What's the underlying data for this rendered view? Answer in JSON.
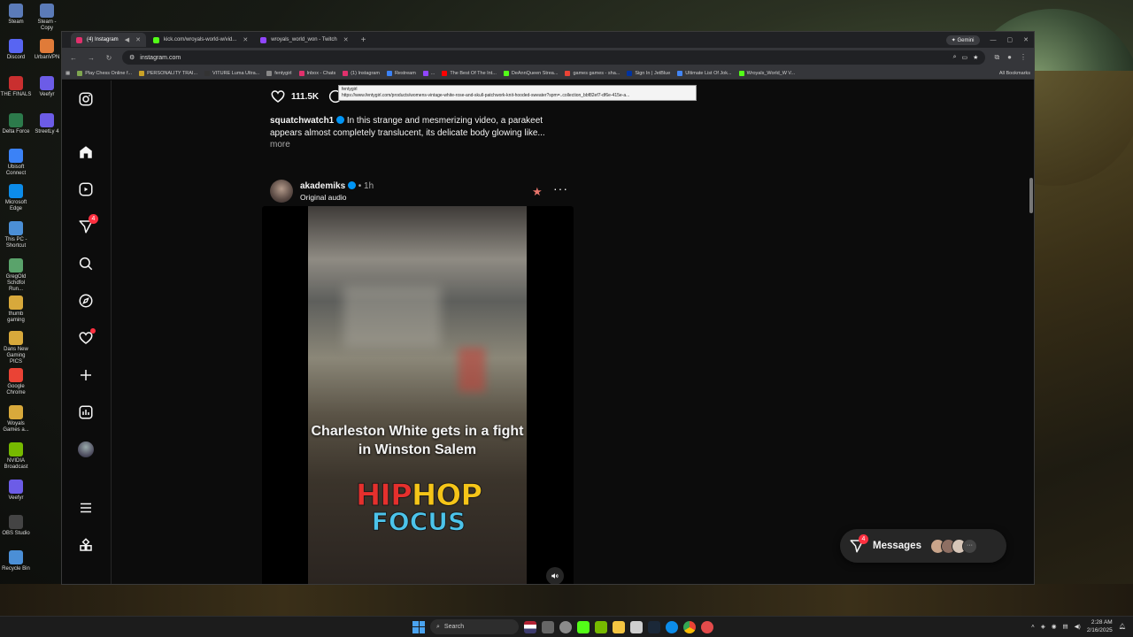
{
  "desktop": {
    "icons": [
      {
        "label": "Steam"
      },
      {
        "label": "Steam - Copy"
      },
      {
        "label": "Discord"
      },
      {
        "label": "UrbanVPN"
      },
      {
        "label": "THE FINALS"
      },
      {
        "label": "Veefyr"
      },
      {
        "label": "Delta Force"
      },
      {
        "label": "StreetLy 4"
      },
      {
        "label": "Ubisoft Connect"
      },
      {
        "label": "Microsoft Edge"
      },
      {
        "label": "This PC - Shortcut"
      },
      {
        "label": "GregOld Schdfol Run..."
      },
      {
        "label": "thumb gaming"
      },
      {
        "label": "Dans New Gaming PICS"
      },
      {
        "label": "Google Chrome"
      },
      {
        "label": "Woyals Games a..."
      },
      {
        "label": "NVIDIA Broadcast"
      },
      {
        "label": "Veefyr"
      },
      {
        "label": "OBS Studio"
      },
      {
        "label": "Recycle Bin"
      }
    ]
  },
  "browser": {
    "tabs": [
      {
        "title": "(4) Instagram",
        "active": true,
        "color": "#e1306c"
      },
      {
        "title": "kick.com/wroyals-world-w/vid...",
        "active": false,
        "color": "#53fc18"
      },
      {
        "title": "wroyals_world_won - Twitch",
        "active": false,
        "color": "#9146ff"
      }
    ],
    "new_tab": "+",
    "gemini": "Gemini",
    "address": "instagram.com",
    "bookmarks": [
      {
        "label": "Play Chess Online f...",
        "color": "#7fa650"
      },
      {
        "label": "PERSONALITY TRAI...",
        "color": "#c9a227"
      },
      {
        "label": "VITURE Luma Ultra...",
        "color": "#333333"
      },
      {
        "label": "fentygirl",
        "color": "#888888"
      },
      {
        "label": "Inbox - Chats",
        "color": "#e1306c"
      },
      {
        "label": "(1) Instagram",
        "color": "#e1306c"
      },
      {
        "label": "Restream",
        "color": "#3b82f6"
      },
      {
        "label": "...",
        "color": "#9146ff"
      },
      {
        "label": "The Best Of The Int...",
        "color": "#ff0000"
      },
      {
        "label": "DeAnnQueen Strea...",
        "color": "#53fc18"
      },
      {
        "label": "games games - sha...",
        "color": "#ea4335"
      },
      {
        "label": "Sign In | JetBlue",
        "color": "#0033a0"
      },
      {
        "label": "Ultimate List Of Jok...",
        "color": "#4285f4"
      },
      {
        "label": "Wroyals_World_W V...",
        "color": "#53fc18"
      }
    ],
    "all_bookmarks": "All Bookmarks",
    "tooltip": {
      "title": "fentygirl",
      "url": "https://www.fentygirl.com/products/womens-vintage-white-rose-and-skull-patchwork-knit-hooded-sweater?spm=..collection_bbf82ef7-df6e-415e-a..."
    }
  },
  "instagram": {
    "sidebar": {
      "notifications_badge": "4"
    },
    "prev_post": {
      "likes": "111.5K",
      "username": "squatchwatch1",
      "caption": "In this strange and mesmerizing video, a parakeet appears almost completely translucent, its delicate body glowing like...",
      "more": "more"
    },
    "post": {
      "username": "akademiks",
      "time": "1h",
      "separator": "•",
      "audio": "Original audio",
      "video_text": "Charleston White gets in a fight in Winston Salem",
      "logo_line1_a": "HIP",
      "logo_line1_b": "HOP",
      "logo_line2": "FOCUS"
    },
    "messages": {
      "label": "Messages",
      "badge": "4",
      "avatar_colors": [
        "#c9a48a",
        "#8e6f63",
        "#d7c6b8"
      ]
    }
  },
  "taskbar": {
    "search": "Search",
    "time": "2:28 AM",
    "date": "2/16/2025"
  }
}
